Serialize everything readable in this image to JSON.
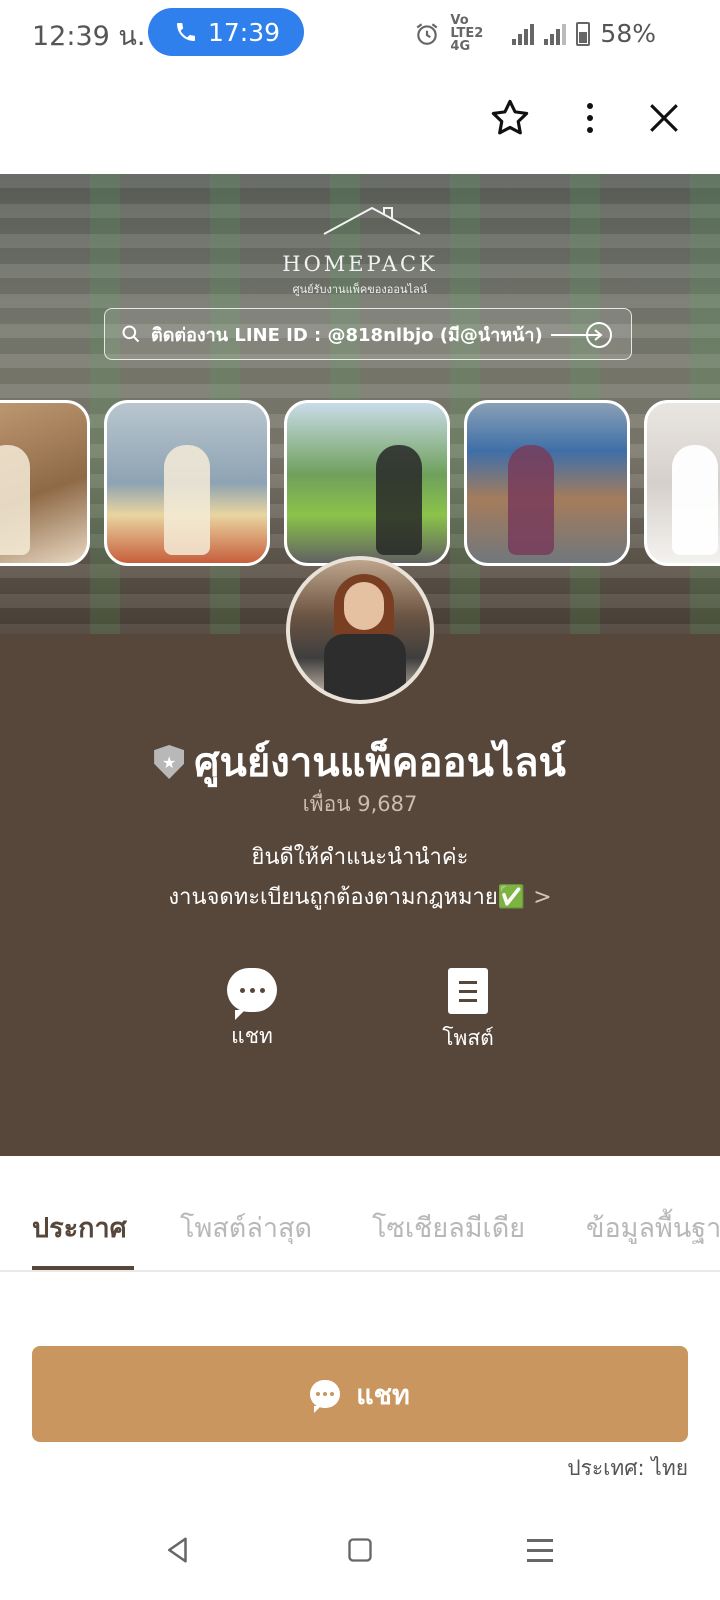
{
  "status_bar": {
    "time": "12:39 น.",
    "call_time": "17:39",
    "network": "Vo LTE2 4G",
    "battery": "58%"
  },
  "app_bar": {
    "favorite_icon": "star-outline-icon",
    "more_icon": "more-vertical-icon",
    "close_icon": "close-icon"
  },
  "cover": {
    "brand_name": "HOMEPACK",
    "brand_tagline": "ศูนย์รับงานแพ็คของออนไลน์",
    "search_text": "ติดต่องาน LINE ID : @818nlbjo (มี@นำหน้า)"
  },
  "profile": {
    "name": "ศูนย์งานแพ็คออนไลน์",
    "friends": "เพื่อน 9,687",
    "description_line1": "ยินดีให้คำแนะนำนำค่ะ",
    "description_line2": "งานจดทะเบียนถูกต้องตามกฎหมาย✅",
    "actions": [
      {
        "label": "แชท",
        "icon": "chat-bubble-icon"
      },
      {
        "label": "โพสต์",
        "icon": "post-document-icon"
      }
    ]
  },
  "tabs": [
    {
      "label": "ประกาศ",
      "active": true
    },
    {
      "label": "โพสต์ล่าสุด",
      "active": false
    },
    {
      "label": "โซเชียลมีเดีย",
      "active": false
    },
    {
      "label": "ข้อมูลพื้นฐาน",
      "active": false
    }
  ],
  "chat_button": {
    "label": "แชท"
  },
  "country": "ประเทศ: ไทย",
  "colors": {
    "panel": "#57463a",
    "chat_button": "#c8965e",
    "call_pill": "#2f80ed"
  }
}
